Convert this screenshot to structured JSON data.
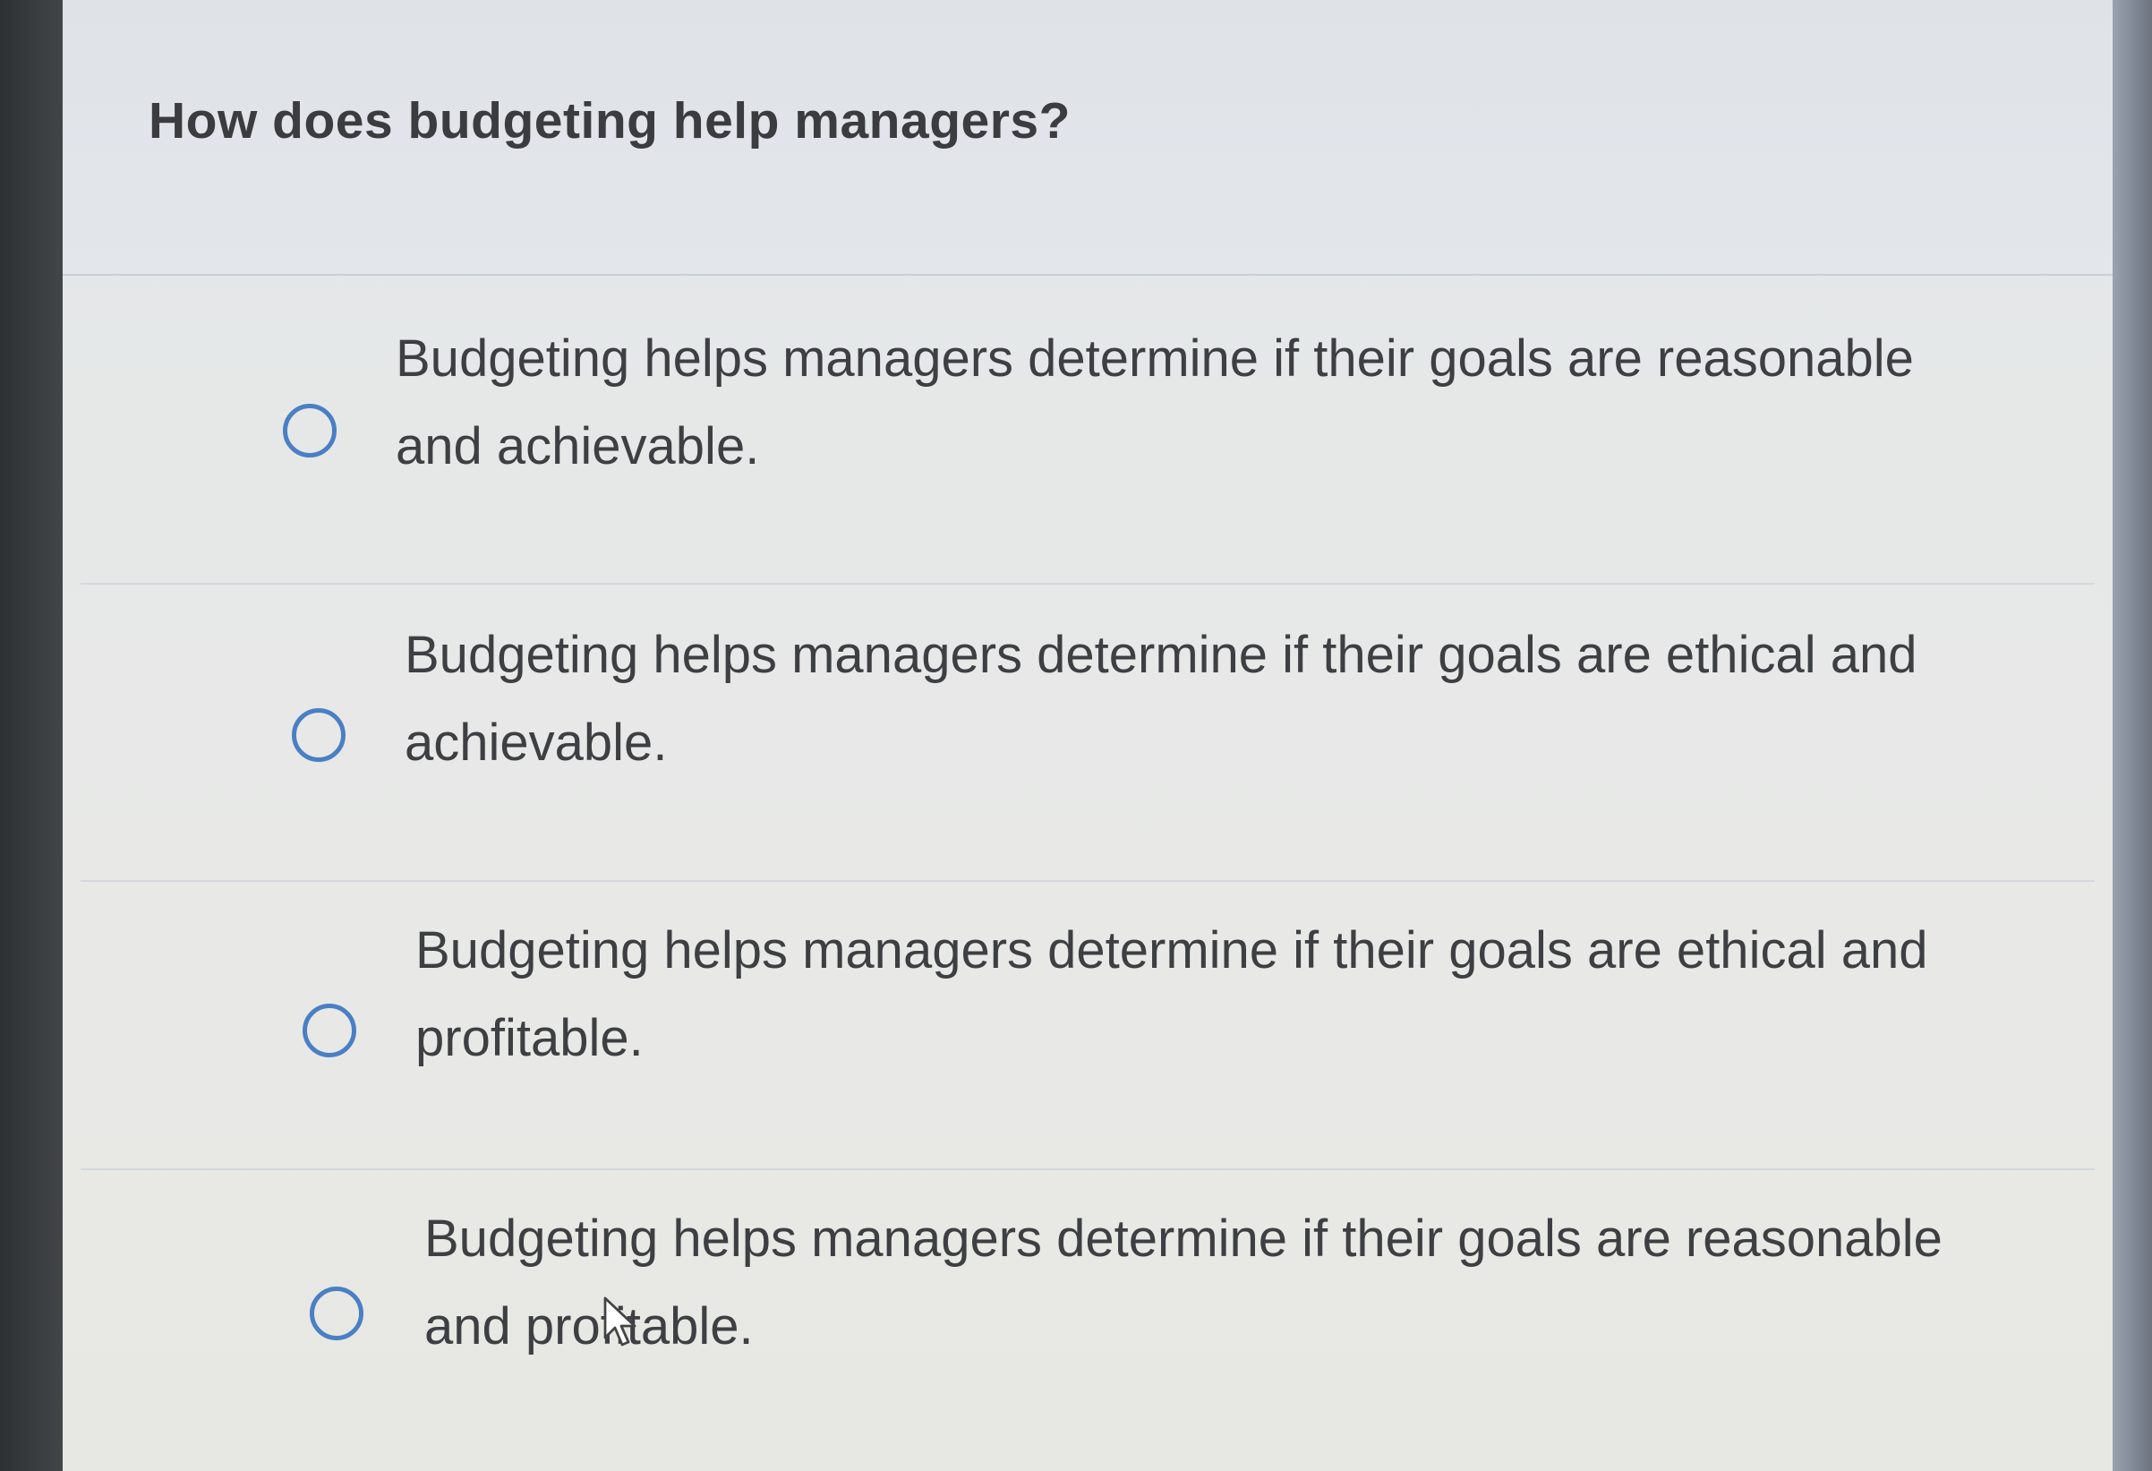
{
  "question": {
    "text": "How does budgeting help managers?"
  },
  "options": [
    {
      "label": "Budgeting helps managers determine if their goals are reasonable and achievable.",
      "selected": false
    },
    {
      "label": "Budgeting helps managers determine if their goals are ethical and achievable.",
      "selected": false
    },
    {
      "label": "Budgeting helps managers determine if their goals are ethical and profitable.",
      "selected": false
    },
    {
      "label": "Budgeting helps managers determine if their goals are reasonable and profitable.",
      "selected": false
    }
  ],
  "colors": {
    "radio_border": "#4a7fc4",
    "text": "#3d3f42",
    "background": "#e7e8e6"
  }
}
